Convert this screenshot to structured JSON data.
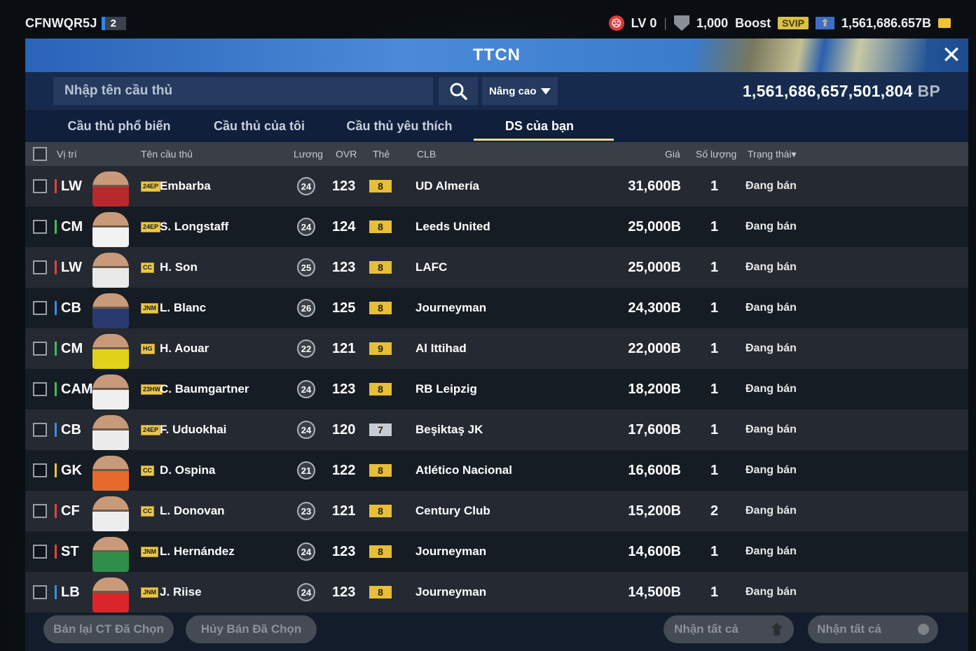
{
  "topbar": {
    "account_id": "CFNWQR5J",
    "level_badge": "2",
    "lv": "LV 0",
    "shield_value": "1,000",
    "boost_label": "Boost",
    "svip_label": "SVIP",
    "boost_arrow": "⇪",
    "coins": "1,561,686.657B"
  },
  "header": {
    "title": "TTCN",
    "close": "✕"
  },
  "search": {
    "placeholder": "Nhập tên cầu thủ",
    "advanced_label": "Nâng cao",
    "bp_value": "1,561,686,657,501,804",
    "bp_unit": "BP"
  },
  "tabs": [
    "Cầu thủ phổ biến",
    "Cầu thủ của tôi",
    "Cầu thủ yêu thích",
    "DS của bạn"
  ],
  "columns": {
    "position": "Vị trí",
    "name": "Tên cầu thủ",
    "salary": "Lương",
    "ovr": "OVR",
    "card": "Thẻ",
    "club": "CLB",
    "price": "Giá",
    "quantity": "Số lượng",
    "status": "Trạng thái▾"
  },
  "rows": [
    {
      "pos": "LW",
      "pos_color": "#e8423a",
      "season": "24EP",
      "name": "Embarba",
      "salary": "24",
      "ovr": "123",
      "card": "8",
      "card_color": "#e6be3a",
      "club": "UD Almería",
      "price": "31,600B",
      "qty": "1",
      "status": "Đang bán",
      "kit": "#b8282c"
    },
    {
      "pos": "CM",
      "pos_color": "#3fbf5a",
      "season": "24EP",
      "name": "S. Longstaff",
      "salary": "24",
      "ovr": "124",
      "card": "8",
      "card_color": "#e6be3a",
      "club": "Leeds United",
      "price": "25,000B",
      "qty": "1",
      "status": "Đang bán",
      "kit": "#f2f2f2"
    },
    {
      "pos": "LW",
      "pos_color": "#e8423a",
      "season": "CC",
      "name": "H. Son",
      "salary": "25",
      "ovr": "123",
      "card": "8",
      "card_color": "#e6be3a",
      "club": "LAFC",
      "price": "25,000B",
      "qty": "1",
      "status": "Đang bán",
      "kit": "#e9e9e9"
    },
    {
      "pos": "CB",
      "pos_color": "#3a8ee8",
      "season": "JNM",
      "name": "L. Blanc",
      "salary": "26",
      "ovr": "125",
      "card": "8",
      "card_color": "#e6be3a",
      "club": "Journeyman",
      "price": "24,300B",
      "qty": "1",
      "status": "Đang bán",
      "kit": "#2a3a6e"
    },
    {
      "pos": "CM",
      "pos_color": "#3fbf5a",
      "season": "HG",
      "name": "H. Aouar",
      "salary": "22",
      "ovr": "121",
      "card": "9",
      "card_color": "#e6be3a",
      "club": "Al Ittihad",
      "price": "22,000B",
      "qty": "1",
      "status": "Đang bán",
      "kit": "#e0d21a"
    },
    {
      "pos": "CAM",
      "pos_color": "#3fbf5a",
      "season": "23HW",
      "name": "C. Baumgartner",
      "salary": "24",
      "ovr": "123",
      "card": "8",
      "card_color": "#e6be3a",
      "club": "RB Leipzig",
      "price": "18,200B",
      "qty": "1",
      "status": "Đang bán",
      "kit": "#f0f0f0"
    },
    {
      "pos": "CB",
      "pos_color": "#3a8ee8",
      "season": "24EP",
      "name": "F. Uduokhai",
      "salary": "24",
      "ovr": "120",
      "card": "7",
      "card_color": "#c7ccd4",
      "club": "Beşiktaş JK",
      "price": "17,600B",
      "qty": "1",
      "status": "Đang bán",
      "kit": "#ececec"
    },
    {
      "pos": "GK",
      "pos_color": "#e8c53a",
      "season": "CC",
      "name": "D. Ospina",
      "salary": "21",
      "ovr": "122",
      "card": "8",
      "card_color": "#e6be3a",
      "club": "Atlético Nacional",
      "price": "16,600B",
      "qty": "1",
      "status": "Đang bán",
      "kit": "#e86a2a"
    },
    {
      "pos": "CF",
      "pos_color": "#e8423a",
      "season": "CC",
      "name": "L. Donovan",
      "salary": "23",
      "ovr": "121",
      "card": "8",
      "card_color": "#e6be3a",
      "club": "Century Club",
      "price": "15,200B",
      "qty": "2",
      "status": "Đang bán",
      "kit": "#ededed"
    },
    {
      "pos": "ST",
      "pos_color": "#e8423a",
      "season": "JNM",
      "name": "L. Hernández",
      "salary": "24",
      "ovr": "123",
      "card": "8",
      "card_color": "#e6be3a",
      "club": "Journeyman",
      "price": "14,600B",
      "qty": "1",
      "status": "Đang bán",
      "kit": "#2f8f4a"
    },
    {
      "pos": "LB",
      "pos_color": "#3a8ee8",
      "season": "JNM",
      "name": "J. Riise",
      "salary": "24",
      "ovr": "123",
      "card": "8",
      "card_color": "#e6be3a",
      "club": "Journeyman",
      "price": "14,500B",
      "qty": "1",
      "status": "Đang bán",
      "kit": "#d8262a"
    }
  ],
  "bottom": {
    "resell_label": "Bán lại CT Đã Chọn",
    "cancel_label": "Hủy Bán Đã Chọn",
    "claim_all_label": "Nhận tất cả",
    "claim_all_label_2": "Nhận tất cả"
  }
}
